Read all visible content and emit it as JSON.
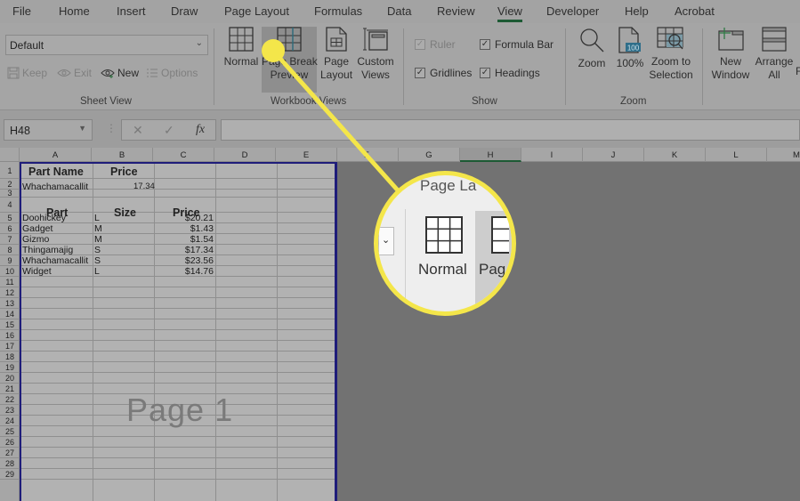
{
  "menu": {
    "tabs": [
      "File",
      "Home",
      "Insert",
      "Draw",
      "Page Layout",
      "Formulas",
      "Data",
      "Review",
      "View",
      "Developer",
      "Help",
      "Acrobat"
    ],
    "active_tab": "View"
  },
  "ribbon": {
    "sheet_view": {
      "dropdown_value": "Default",
      "keep": "Keep",
      "exit": "Exit",
      "new": "New",
      "options": "Options",
      "label": "Sheet View"
    },
    "workbook_views": {
      "normal": "Normal",
      "page_break_1": "Page Break",
      "page_break_2": "Preview",
      "page_layout_1": "Page",
      "page_layout_2": "Layout",
      "custom_views_1": "Custom",
      "custom_views_2": "Views",
      "label": "Workbook Views"
    },
    "show": {
      "ruler": "Ruler",
      "formula_bar": "Formula Bar",
      "gridlines": "Gridlines",
      "headings": "Headings",
      "label": "Show"
    },
    "zoom": {
      "zoom": "Zoom",
      "zoom100": "100%",
      "zoom100_badge": "100",
      "zoom_sel_1": "Zoom to",
      "zoom_sel_2": "Selection",
      "label": "Zoom"
    },
    "window": {
      "new_window_1": "New",
      "new_window_2": "Window",
      "arrange_1": "Arrange",
      "arrange_2": "All",
      "freeze_partial": "F"
    }
  },
  "formula_bar": {
    "name_box": "H48",
    "cancel": "✕",
    "enter": "✓",
    "fx": "fx",
    "value": ""
  },
  "columns": [
    "A",
    "B",
    "C",
    "D",
    "E",
    "F",
    "G",
    "H",
    "I",
    "J",
    "K",
    "L",
    "M"
  ],
  "selected_column": "H",
  "rows": [
    "1",
    "2",
    "3",
    "4",
    "5",
    "6",
    "7",
    "8",
    "9",
    "10",
    "11",
    "12",
    "13",
    "14",
    "15",
    "16",
    "17",
    "18",
    "19",
    "20",
    "21",
    "22",
    "23",
    "24",
    "25",
    "26",
    "27",
    "28",
    "29"
  ],
  "sheet": {
    "header1": {
      "a": "Part Name",
      "b": "Price"
    },
    "row2": {
      "a": "Whachamacallit",
      "b": "17.34"
    },
    "header2": {
      "a": "Part",
      "b": "Size",
      "c": "Price"
    },
    "items": [
      {
        "part": "Doohickey",
        "size": "L",
        "price": "$20.21"
      },
      {
        "part": "Gadget",
        "size": "M",
        "price": "$1.43"
      },
      {
        "part": "Gizmo",
        "size": "M",
        "price": "$1.54"
      },
      {
        "part": "Thingamajig",
        "size": "S",
        "price": "$17.34"
      },
      {
        "part": "Whachamacallit",
        "size": "S",
        "price": "$23.56"
      },
      {
        "part": "Widget",
        "size": "L",
        "price": "$14.76"
      }
    ],
    "page_watermark": "Page 1"
  },
  "callout": {
    "tab_partial": "Page La",
    "normal": "Normal",
    "page_partial": "Pag"
  },
  "colors": {
    "highlight": "#f4e64a",
    "page_border": "#1f1d7a",
    "active_tab_underline": "#1d5a34"
  }
}
